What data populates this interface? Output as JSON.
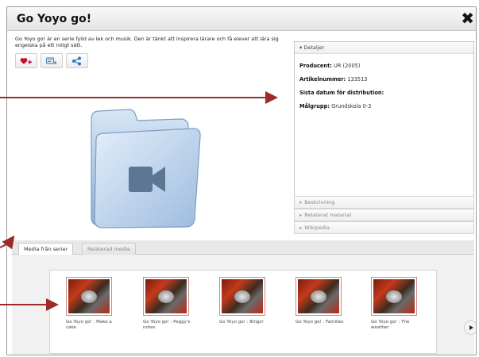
{
  "window": {
    "title": "Go Yoyo go!",
    "close_glyph": "✖",
    "description": "Go Yoyo go! är en serie fylld av lek och musik. Den är tänkt att inspirera lärare och få elever att lära sig engelska på ett roligt sätt."
  },
  "actions": [
    {
      "icon": "heart-add-icon"
    },
    {
      "icon": "playlist-add-icon"
    },
    {
      "icon": "share-icon"
    }
  ],
  "details": {
    "header": "▾ Detaljer",
    "producent_label": "Producent:",
    "producent_value": "UR (2005)",
    "artikel_label": "Artikelnummer:",
    "artikel_value": "133513",
    "sista_label": "Sista datum för distribution:",
    "malgrupp_label": "Målgrupp:",
    "malgrupp_value": "Grundskola 0-3"
  },
  "accordion": [
    "Beskrivning",
    "Relaterat material",
    "Wikipedia"
  ],
  "tabs": [
    "Media från serier",
    "Relaterad media"
  ],
  "media": [
    {
      "caption": "Go Yoyo go! : Make a cake"
    },
    {
      "caption": "Go Yoyo go! : Peggy's notes"
    },
    {
      "caption": "Go Yoyo go! : Bingo!"
    },
    {
      "caption": "Go Yoyo go! : Families"
    },
    {
      "caption": "Go Yoyo go! : The weather"
    }
  ],
  "colors": {
    "annotation_arrow": "#9e2a2a",
    "folder_blue": "#a9c6e6",
    "thumb_border": "#cc8888"
  }
}
